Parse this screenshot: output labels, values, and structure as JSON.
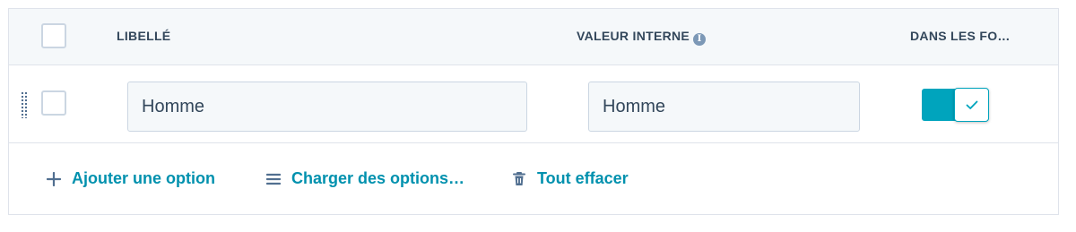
{
  "header": {
    "label_column": "Libellé",
    "internal_value_column": "Valeur interne",
    "in_forms_column": "Dans les fo…"
  },
  "rows": [
    {
      "label_value": "Homme",
      "internal_value": "Homme",
      "in_forms": true
    }
  ],
  "actions": {
    "add_option": "Ajouter une option",
    "load_options": "Charger des options…",
    "clear_all": "Tout effacer"
  },
  "colors": {
    "accent": "#00a4bd",
    "link": "#0091ae",
    "border": "#dfe3eb",
    "header_bg": "#f5f8fa",
    "text": "#33475b"
  },
  "icons": {
    "add": "plus-icon",
    "load": "list-icon",
    "clear": "trash-icon",
    "info": "info-icon",
    "drag": "drag-handle-icon",
    "check": "checkmark-icon"
  }
}
